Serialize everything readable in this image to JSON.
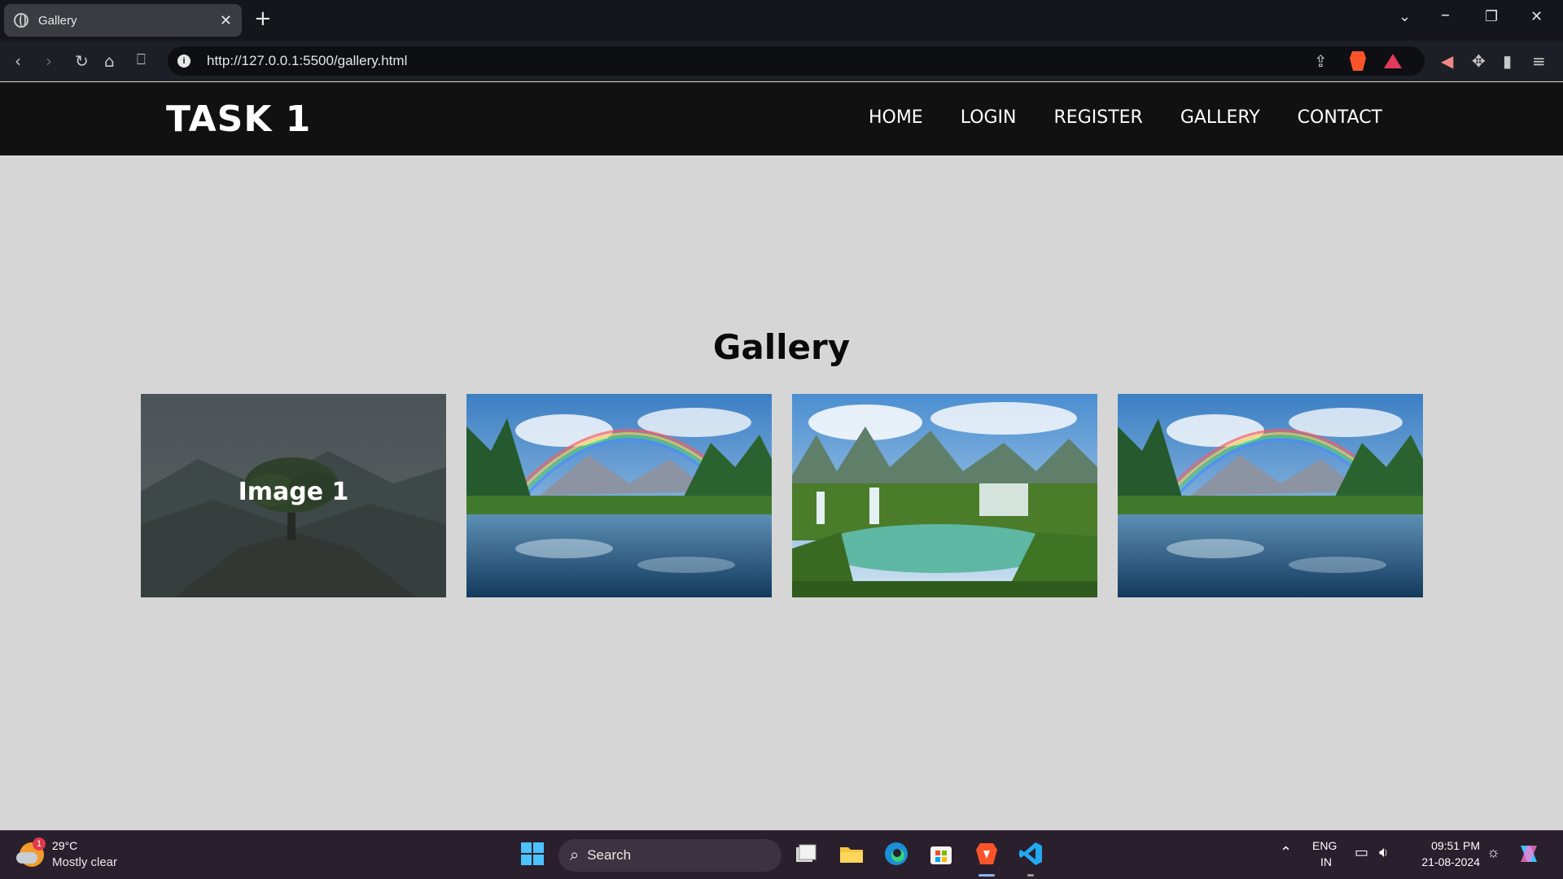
{
  "browser": {
    "tab_title": "Gallery",
    "close_glyph": "✕",
    "new_tab_glyph": "+",
    "url": "http://127.0.0.1:5500/gallery.html"
  },
  "site": {
    "logo": "TASK 1",
    "nav": [
      "HOME",
      "LOGIN",
      "REGISTER",
      "GALLERY",
      "CONTACT"
    ]
  },
  "gallery": {
    "title": "Gallery",
    "images": [
      {
        "caption": "Image 1",
        "scene": "tree-on-hill",
        "hovered": true
      },
      {
        "caption": "",
        "scene": "rainbow-river",
        "hovered": false
      },
      {
        "caption": "",
        "scene": "waterfall-valley",
        "hovered": false
      },
      {
        "caption": "",
        "scene": "rainbow-river",
        "hovered": false
      }
    ]
  },
  "taskbar": {
    "temperature": "29°C",
    "weather": "Mostly clear",
    "notification_count": "1",
    "search_label": "Search",
    "lang_line1": "ENG",
    "lang_line2": "IN",
    "time": "09:51 PM",
    "date": "21-08-2024"
  },
  "colors": {
    "page_bg": "#d6d6d6",
    "header_bg": "#111111",
    "taskbar_bg": "#2a1f2d",
    "brave": "#fb542b"
  }
}
